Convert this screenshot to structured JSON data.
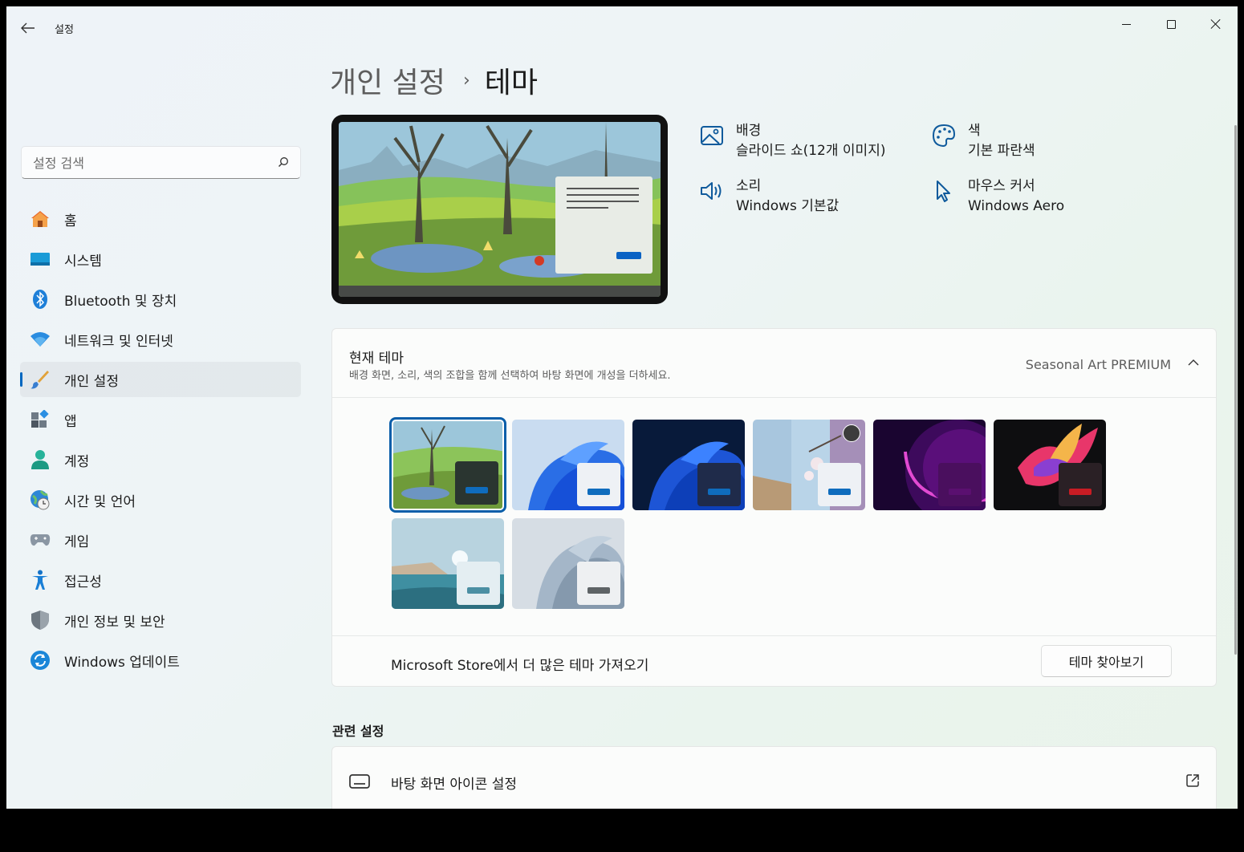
{
  "window": {
    "title": "설정"
  },
  "search": {
    "placeholder": "설정 검색"
  },
  "sidebar": {
    "items": [
      {
        "label": "홈",
        "icon": "home-icon"
      },
      {
        "label": "시스템",
        "icon": "system-icon"
      },
      {
        "label": "Bluetooth 및 장치",
        "icon": "bluetooth-icon"
      },
      {
        "label": "네트워크 및 인터넷",
        "icon": "wifi-icon"
      },
      {
        "label": "개인 설정",
        "icon": "brush-icon",
        "active": true
      },
      {
        "label": "앱",
        "icon": "apps-icon"
      },
      {
        "label": "계정",
        "icon": "account-icon"
      },
      {
        "label": "시간 및 언어",
        "icon": "time-language-icon"
      },
      {
        "label": "게임",
        "icon": "gamepad-icon"
      },
      {
        "label": "접근성",
        "icon": "accessibility-icon"
      },
      {
        "label": "개인 정보 및 보안",
        "icon": "shield-icon"
      },
      {
        "label": "Windows 업데이트",
        "icon": "update-icon"
      }
    ]
  },
  "breadcrumb": {
    "parent": "개인 설정",
    "separator": "›",
    "current": "테마"
  },
  "properties": {
    "background": {
      "title": "배경",
      "value": "슬라이드 쇼(12개 이미지)"
    },
    "color": {
      "title": "색",
      "value": "기본 파란색"
    },
    "sound": {
      "title": "소리",
      "value": "Windows 기본값"
    },
    "cursor": {
      "title": "마우스 커서",
      "value": "Windows Aero"
    }
  },
  "current_theme": {
    "title": "현재 테마",
    "description": "배경 화면, 소리, 색의 조합을 함께 선택하여 바탕 화면에 개성을 더하세요.",
    "selected": "Seasonal Art PREMIUM",
    "themes": [
      {
        "id": "seasonal-art",
        "accent": "#0f6cbd",
        "selected": true
      },
      {
        "id": "windows-light",
        "accent": "#0f6cbd"
      },
      {
        "id": "windows-dark",
        "accent": "#0f6cbd"
      },
      {
        "id": "windows-spotlight",
        "accent": "#0f6cbd"
      },
      {
        "id": "glow",
        "accent": "#5a1070"
      },
      {
        "id": "captured-motion",
        "accent": "#c81c24"
      },
      {
        "id": "sunrise",
        "accent": "#4b8fa3"
      },
      {
        "id": "flow",
        "accent": "#5e6366"
      }
    ]
  },
  "store": {
    "text": "Microsoft Store에서 더 많은 테마 가져오기",
    "button": "테마 찾아보기"
  },
  "related": {
    "title": "관련 설정",
    "items": [
      {
        "label": "바탕 화면 아이콘 설정"
      }
    ]
  },
  "colors": {
    "accent": "#0067c0"
  }
}
